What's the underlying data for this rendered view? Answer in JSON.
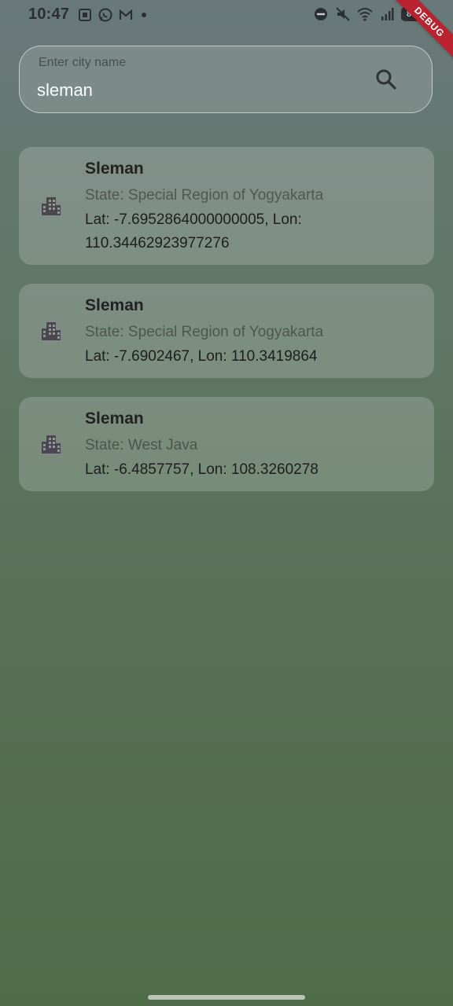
{
  "status_bar": {
    "time": "10:47",
    "battery_level": "86"
  },
  "debug_banner": "DEBUG",
  "search": {
    "label": "Enter city name",
    "value": "sleman",
    "icon": "search-icon"
  },
  "results": [
    {
      "name": "Sleman",
      "state": "State: Special Region of Yogyakarta",
      "coords": "Lat: -7.6952864000000005, Lon: 110.34462923977276",
      "icon": "city-icon"
    },
    {
      "name": "Sleman",
      "state": "State: Special Region of Yogyakarta",
      "coords": "Lat: -7.6902467, Lon: 110.3419864",
      "icon": "city-icon"
    },
    {
      "name": "Sleman",
      "state": "State: West Java",
      "coords": "Lat: -6.4857757, Lon: 108.3260278",
      "icon": "city-icon"
    }
  ]
}
